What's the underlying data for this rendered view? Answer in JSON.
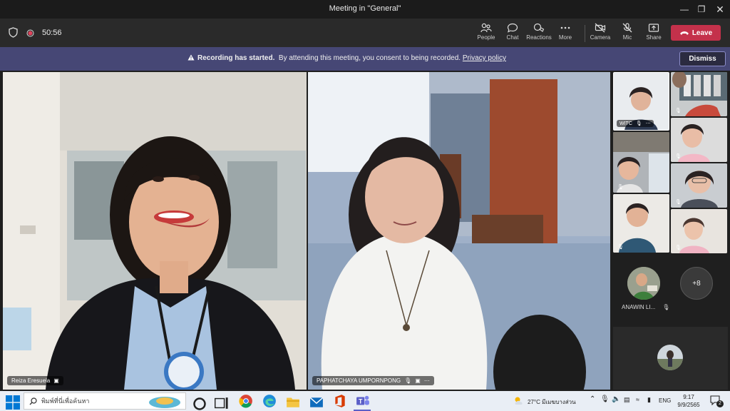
{
  "window": {
    "title": "Meeting in \"General\""
  },
  "toolbar": {
    "timer": "50:56",
    "people_label": "People",
    "chat_label": "Chat",
    "reactions_label": "Reactions",
    "more_label": "More",
    "camera_label": "Camera",
    "mic_label": "Mic",
    "share_label": "Share",
    "leave_label": "Leave"
  },
  "banner": {
    "title": "Recording has started.",
    "message": "By attending this meeting, you consent to being recorded.",
    "link": "Privacy policy",
    "dismiss_label": "Dismiss"
  },
  "participants": {
    "main_left": "Reiza Eresuela",
    "main_right": "PAPHATCHAYA UMPORNPONG",
    "thumb_first": "WITC",
    "avatar_name": "ANAWIN LI...",
    "overflow": "+8"
  },
  "taskbar": {
    "search_placeholder": "พิมพ์ที่นี่เพื่อค้นหา",
    "weather": "27°C  มีเมฆบางส่วน",
    "language": "ENG",
    "time": "9:17",
    "date": "9/9/2565",
    "notification_count": "2"
  }
}
